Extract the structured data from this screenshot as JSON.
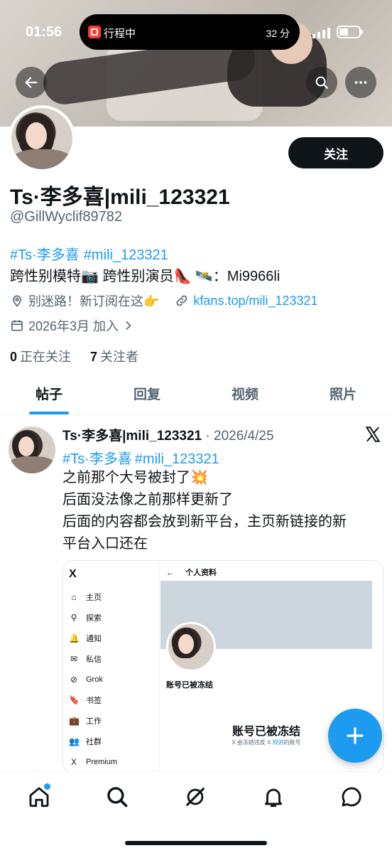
{
  "status_bar": {
    "time": "01:56",
    "island_label": "行程中",
    "island_minutes": "32 分"
  },
  "profile": {
    "follow_label": "关注",
    "name": "Ts·李多喜|mili_123321",
    "handle": "@GillWyclif89782",
    "bio_tags": [
      "#Ts·李多喜",
      "#mili_123321"
    ],
    "bio_line": "跨性别模特📷 跨性别演员👠 🛰️：Mi9966li",
    "location": "别迷路！新订阅在这👉",
    "website": "kfans.top/mili_123321",
    "joined": "2026年3月 加入",
    "following_count": "0",
    "following_label": "正在关注",
    "followers_count": "7",
    "followers_label": "关注者"
  },
  "tabs": [
    {
      "label": "帖子",
      "active": true
    },
    {
      "label": "回复",
      "active": false
    },
    {
      "label": "视频",
      "active": false
    },
    {
      "label": "照片",
      "active": false
    }
  ],
  "post": {
    "author": "Ts·李多喜|mili_123321",
    "date": "· 2026/4/25",
    "tags": [
      "#Ts·李多喜",
      "#mili_123321"
    ],
    "lines": [
      "之前那个大号被封了💥",
      "后面没法像之前那样更新了",
      "后面的内容都会放到新平台，主页新链接的新",
      "平台入口还在"
    ],
    "embed": {
      "logo": "X",
      "menu": [
        {
          "icon": "⌂",
          "label": "主页"
        },
        {
          "icon": "⚲",
          "label": "探索"
        },
        {
          "icon": "🔔",
          "label": "通知"
        },
        {
          "icon": "✉",
          "label": "私信"
        },
        {
          "icon": "⊘",
          "label": "Grok"
        },
        {
          "icon": "🔖",
          "label": "书签"
        },
        {
          "icon": "💼",
          "label": "工作"
        },
        {
          "icon": "👥",
          "label": "社群"
        },
        {
          "icon": "X",
          "label": "Premium"
        }
      ],
      "back_arrow": "←",
      "page_title": "个人资料",
      "frozen_small": "账号已被冻结",
      "frozen_big": "账号已被冻结",
      "frozen_sub_a": "X 会冻结违反 X ",
      "frozen_sub_link": "规则",
      "frozen_sub_b": "的账号"
    }
  },
  "colors": {
    "accent": "#1d9bf0",
    "text": "#0f1419",
    "muted": "#536471"
  }
}
